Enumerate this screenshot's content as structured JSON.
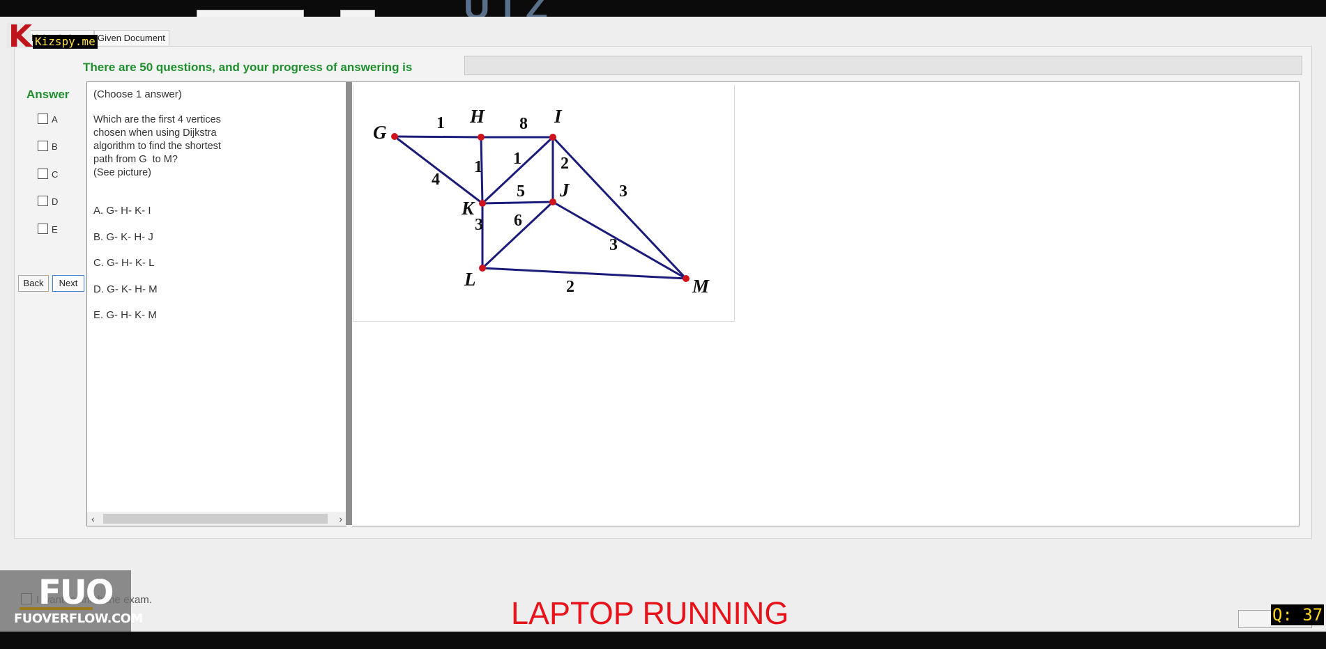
{
  "header": {
    "title_partial": "U I Z"
  },
  "watermarks": {
    "kizspy_logo_letter": "K",
    "kizspy_text": "Kizspy.me",
    "fuo_big": "FUO",
    "fuo_small": "FUOVERFLOW.COM",
    "laptop_status": "LAPTOP RUNNING",
    "question_counter": "Q: 37"
  },
  "tabs": {
    "multiple_choice": "ltiple Choices",
    "given_document": "Given Document"
  },
  "progress": {
    "label": "There are 50 questions, and your progress of answering is",
    "fraction": 0.0
  },
  "answer_panel": {
    "title": "Answer",
    "options": [
      "A",
      "B",
      "C",
      "D",
      "E"
    ],
    "back_label": "Back",
    "next_label": "Next"
  },
  "question": {
    "instruction": "(Choose 1 answer)",
    "lines": [
      "Which are the first 4 vertices",
      "chosen when using Dijkstra",
      "algorithm to find the shortest",
      "path from G  to M?",
      "(See picture)"
    ],
    "choices": [
      "A.  G- H- K- I",
      "B.  G- K- H- J",
      "C.  G- H- K- L",
      "D.  G- K- H- M",
      "E.  G- H- K- M"
    ]
  },
  "graph": {
    "nodes": [
      "G",
      "H",
      "I",
      "J",
      "K",
      "L",
      "M"
    ],
    "edges": [
      {
        "from": "G",
        "to": "H",
        "weight": "1"
      },
      {
        "from": "H",
        "to": "I",
        "weight": "8"
      },
      {
        "from": "G",
        "to": "K",
        "weight": "4"
      },
      {
        "from": "H",
        "to": "K",
        "weight": "1"
      },
      {
        "from": "K",
        "to": "I",
        "weight": "1"
      },
      {
        "from": "I",
        "to": "J",
        "weight": "2"
      },
      {
        "from": "K",
        "to": "J",
        "weight": "5"
      },
      {
        "from": "I",
        "to": "M",
        "weight": "3"
      },
      {
        "from": "K",
        "to": "L",
        "weight": "3"
      },
      {
        "from": "L",
        "to": "J",
        "weight": "6"
      },
      {
        "from": "J",
        "to": "M",
        "weight": "3"
      },
      {
        "from": "L",
        "to": "M",
        "weight": "2"
      }
    ],
    "edge_color": "#1b1b7a",
    "node_color": "#d0141e"
  },
  "footer": {
    "finish_label": "I want to finish the exam."
  }
}
